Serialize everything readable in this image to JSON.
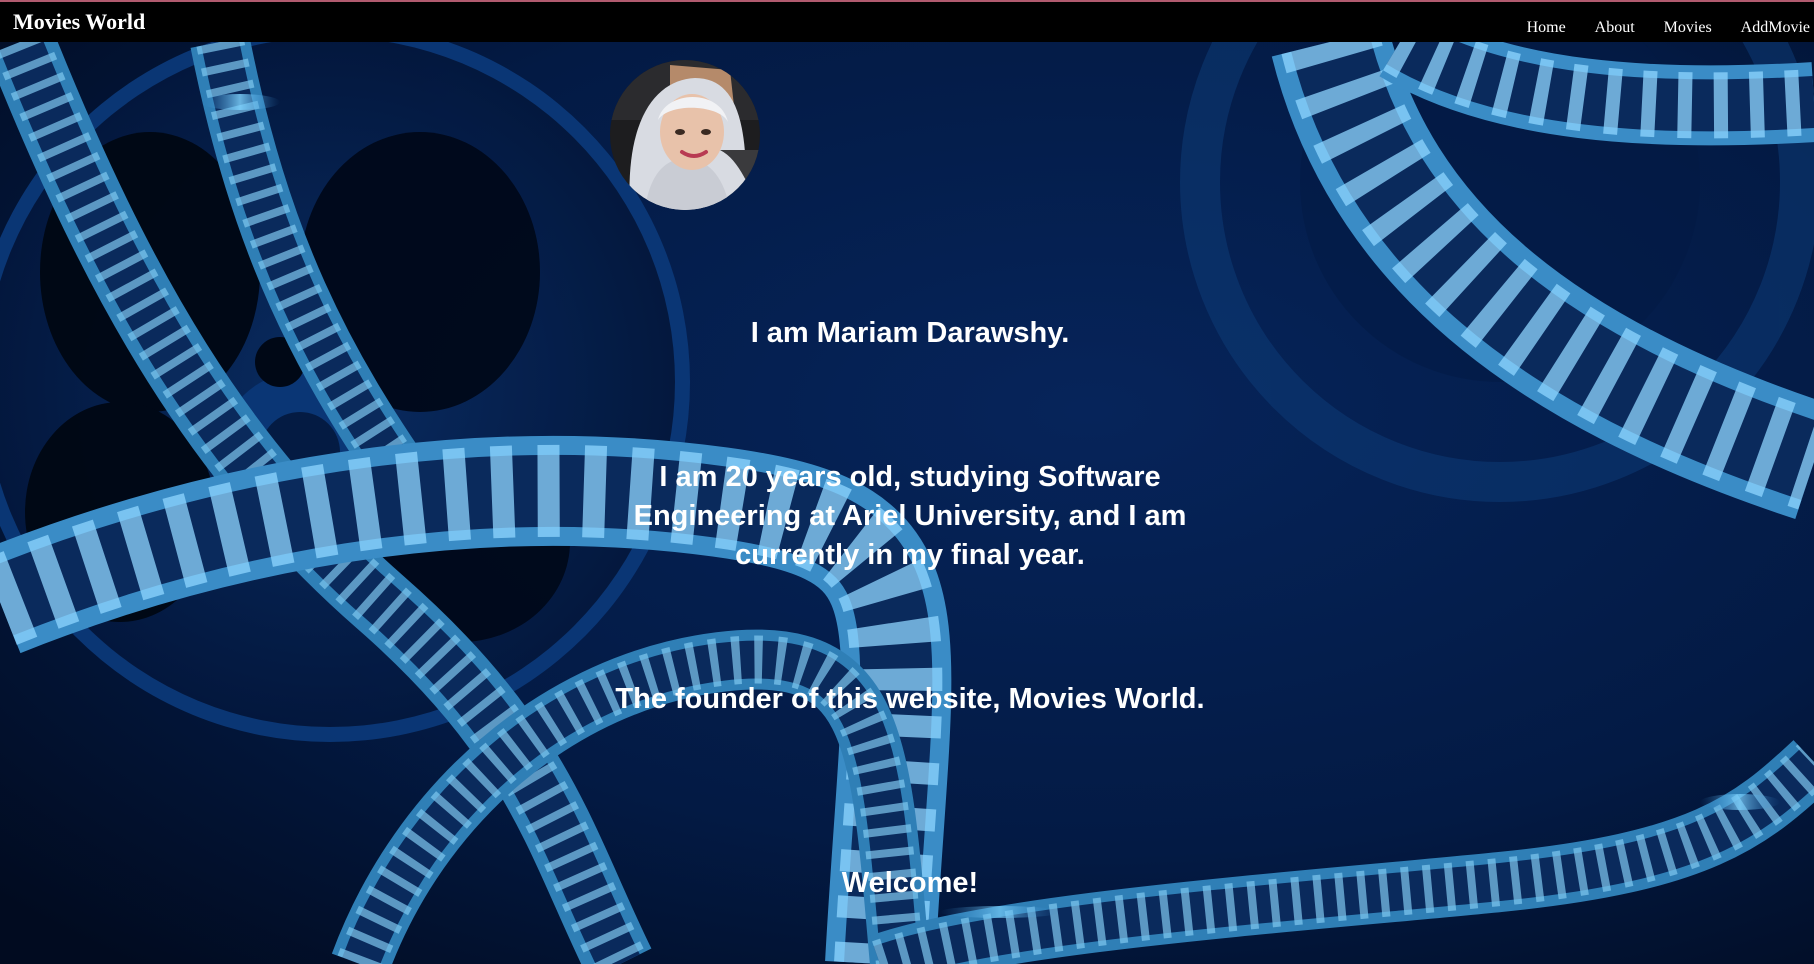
{
  "navbar": {
    "brand": "Movies World",
    "links": [
      "Home",
      "About",
      "Movies",
      "AddMovie"
    ]
  },
  "about": {
    "name_line": "I am Mariam Darawshy.",
    "bio_line": "I am 20 years old, studying Software Engineering at Ariel University, and I am currently in my final year.",
    "founder_line": "The founder of this website, Movies World.",
    "welcome_line": "Welcome!"
  },
  "colors": {
    "navbar_bg": "#000000",
    "navbar_accent": "#b05a6e",
    "page_bg": "#02112e",
    "film_strip": "#3d8fc4",
    "text": "#ffffff"
  },
  "icons": {
    "avatar": "profile-photo"
  }
}
